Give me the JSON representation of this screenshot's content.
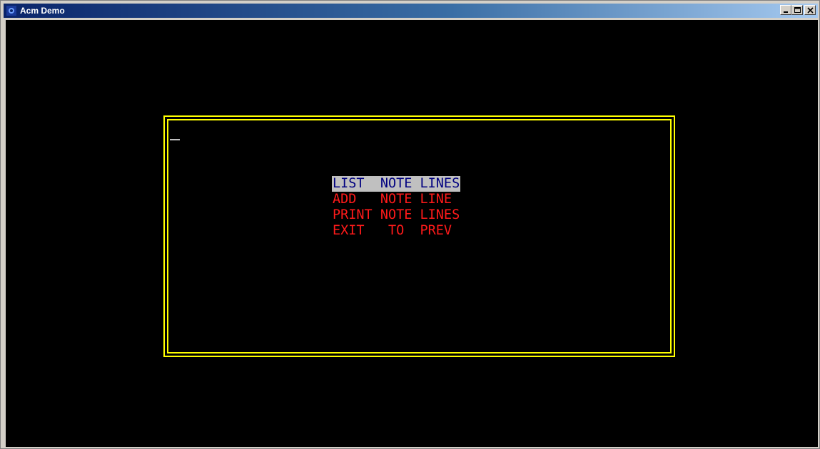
{
  "window": {
    "title": "Acm Demo",
    "icon": "acm-app-icon",
    "controls": {
      "minimize": "minimize-icon",
      "maximize": "maximize-icon",
      "close": "close-icon"
    }
  },
  "terminal": {
    "background": "#000000",
    "frame_color": "#ffff00",
    "cursor": "_",
    "menu": {
      "selected_color_bg": "#c0c0c0",
      "selected_color_fg": "#000080",
      "item_color": "#ff1a1a",
      "items": [
        {
          "label": "LIST  NOTE LINES",
          "selected": true
        },
        {
          "label": "ADD   NOTE LINE",
          "selected": false
        },
        {
          "label": "PRINT NOTE LINES",
          "selected": false
        },
        {
          "label": "EXIT   TO  PREV",
          "selected": false
        }
      ]
    }
  }
}
